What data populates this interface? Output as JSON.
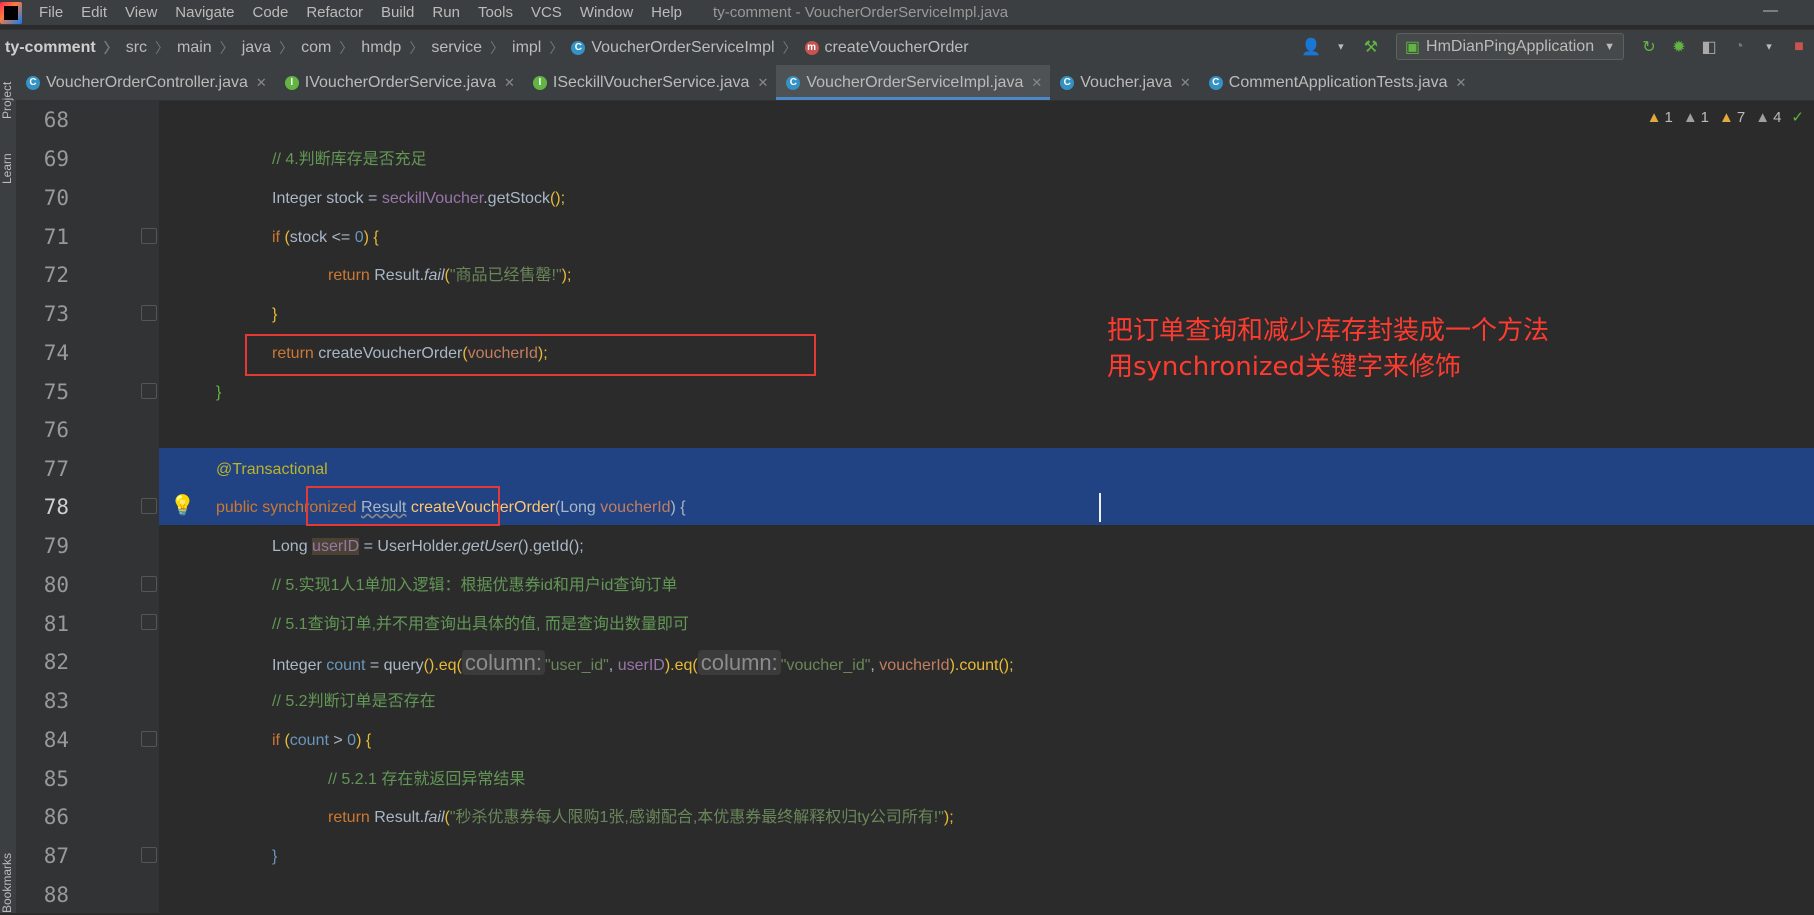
{
  "app": {
    "window_title": "ty-comment - VoucherOrderServiceImpl.java",
    "menu": [
      "File",
      "Edit",
      "View",
      "Navigate",
      "Code",
      "Refactor",
      "Build",
      "Run",
      "Tools",
      "VCS",
      "Window",
      "Help"
    ],
    "minimize": "—"
  },
  "breadcrumb": [
    "ty-comment",
    "src",
    "main",
    "java",
    "com",
    "hmdp",
    "service",
    "impl",
    "VoucherOrderServiceImpl",
    "createVoucherOrder"
  ],
  "toolbar": {
    "run_config": "HmDianPingApplication"
  },
  "tabs": [
    {
      "label": "VoucherOrderController.java",
      "icon": "class-icon"
    },
    {
      "label": "IVoucherOrderService.java",
      "icon": "interface-icon"
    },
    {
      "label": "ISeckillVoucherService.java",
      "icon": "interface-icon"
    },
    {
      "label": "VoucherOrderServiceImpl.java",
      "icon": "class-icon",
      "active": true
    },
    {
      "label": "Voucher.java",
      "icon": "class-icon"
    },
    {
      "label": "CommentApplicationTests.java",
      "icon": "test-class-icon"
    }
  ],
  "side_tools": {
    "project": "Project",
    "learn": "Learn",
    "bookmarks": "Bookmarks"
  },
  "inspections": {
    "warn1": "1",
    "warn2": "1",
    "warn3": "7",
    "warn4": "4"
  },
  "code": {
    "line_numbers": [
      "68",
      "69",
      "70",
      "71",
      "72",
      "73",
      "74",
      "75",
      "76",
      "77",
      "78",
      "79",
      "80",
      "81",
      "82",
      "83",
      "84",
      "85",
      "86",
      "87",
      "88"
    ],
    "l69_comment": "// 4.判断库存是否充足",
    "l70": {
      "type": "Integer",
      "var": "stock",
      "eq": " = ",
      "field": "seckillVoucher",
      "call": ".getStock",
      "tail": "();"
    },
    "l71": {
      "kw": "if",
      "open": " (",
      "cond": "stock <= ",
      "num": "0",
      "close": ") {"
    },
    "l72": {
      "kw": "return",
      "cls": " Result.",
      "method": "fail",
      "open": "(",
      "str": "\"商品已经售罄!\"",
      "close": ");"
    },
    "l73": "}",
    "l74": {
      "kw": "return",
      "call": " createVoucherOrder",
      "open": "(",
      "arg": "voucherId",
      "close": ");"
    },
    "l75": "}",
    "l77": "@Transactional",
    "l78": {
      "kw1": "public",
      "kw2": "synchronized",
      "type": "Result",
      "name": "createVoucherOrder",
      "open": "(",
      "ptype": "Long",
      "param": "voucherId",
      "close": ") {"
    },
    "l79": {
      "type": "Long",
      "var": "userID",
      "eq": " = UserHolder.",
      "method": "getUser",
      "tail": "().getId();"
    },
    "l80_comment": "// 5.实现1人1单加入逻辑：根据优惠券id和用户id查询订单",
    "l81_comment": "// 5.1查询订单,并不用查询出具体的值, 而是查询出数量即可",
    "l82": {
      "type": "Integer",
      "var": "count",
      "eq": " = ",
      "q": "query",
      "p1": "().eq(",
      "hint1": "column:",
      "s1": "\"user_id\"",
      "comma": ", ",
      "v1": "userID",
      "p2": ").eq(",
      "hint2": "column:",
      "s2": "\"voucher_id\"",
      "comma2": ", ",
      "v2": "voucherId",
      "p3": ").count();"
    },
    "l83_comment": "// 5.2判断订单是否存在",
    "l84": {
      "kw": "if",
      "open": " (",
      "var": "count",
      "cmp": " > ",
      "num": "0",
      "close": ") {"
    },
    "l85_comment": "// 5.2.1 存在就返回异常结果",
    "l86": {
      "kw": "return",
      "cls": " Result.",
      "method": "fail",
      "open": "(",
      "str": "\"秒杀优惠券每人限购1张,感谢配合,本优惠券最终解释权归ty公司所有!\"",
      "close": ");"
    },
    "l87": "}"
  },
  "annotation_note": {
    "line1": "把订单查询和减少库存封装成一个方法",
    "line2": "用synchronized关键字来修饰"
  },
  "colors": {
    "editor_bg": "#2b2b2b",
    "selection": "#214283",
    "keyword": "#cc7832",
    "comment": "#629755",
    "string": "#6a8759",
    "annotation_red": "#e53935"
  }
}
